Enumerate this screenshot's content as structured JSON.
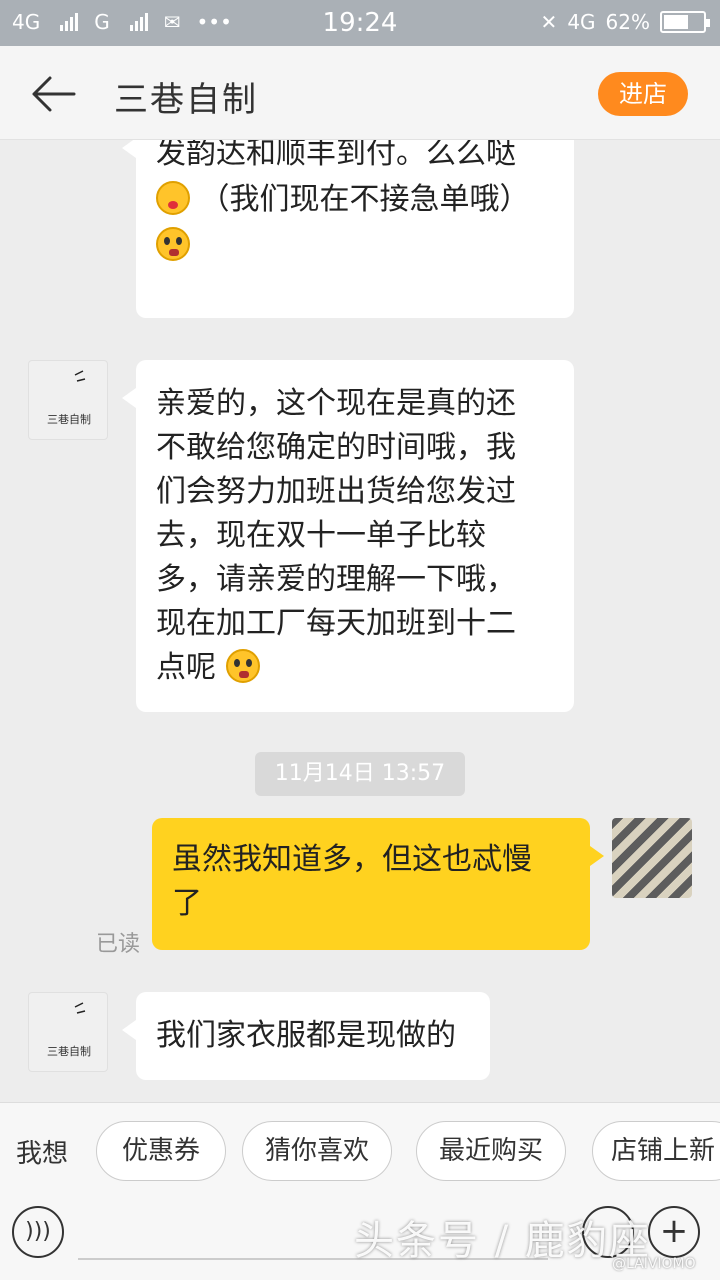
{
  "status_bar": {
    "net1": "4G",
    "net2": "G",
    "time": "19:24",
    "net3": "4G",
    "battery": "62%",
    "battery_level": 0.62
  },
  "header": {
    "title": "三巷自制",
    "enter_shop": "进店"
  },
  "messages": [
    {
      "line1": "发韵达和顺丰到付。么么哒",
      "line2": "（我们现在不接急单哦）"
    },
    {
      "avatar_text": "三巷自制",
      "lines": [
        "亲爱的，这个现在是真的还",
        "不敢给您确定的时间哦，我",
        "们会努力加班出货给您发过",
        "去，现在双十一单子比较",
        "多，请亲爱的理解一下哦，",
        "现在加工厂每天加班到十二",
        "点呢"
      ]
    },
    {
      "timestamp": "11月14日 13:57"
    },
    {
      "lines": [
        "虽然我知道多，但这也忒慢",
        "了"
      ],
      "read_status": "已读"
    },
    {
      "avatar_text": "三巷自制",
      "text": "我们家衣服都是现做的"
    }
  ],
  "suggestions": {
    "label": "我想",
    "chips": [
      "优惠券",
      "猜你喜欢",
      "最近购买",
      "店铺上新"
    ]
  },
  "watermark": {
    "main": "头条号 / 鹿豹座",
    "small": "@LAIVIOMO"
  },
  "colors": {
    "accent": "#ff8a1e",
    "user_bubble": "#ffd21f"
  }
}
